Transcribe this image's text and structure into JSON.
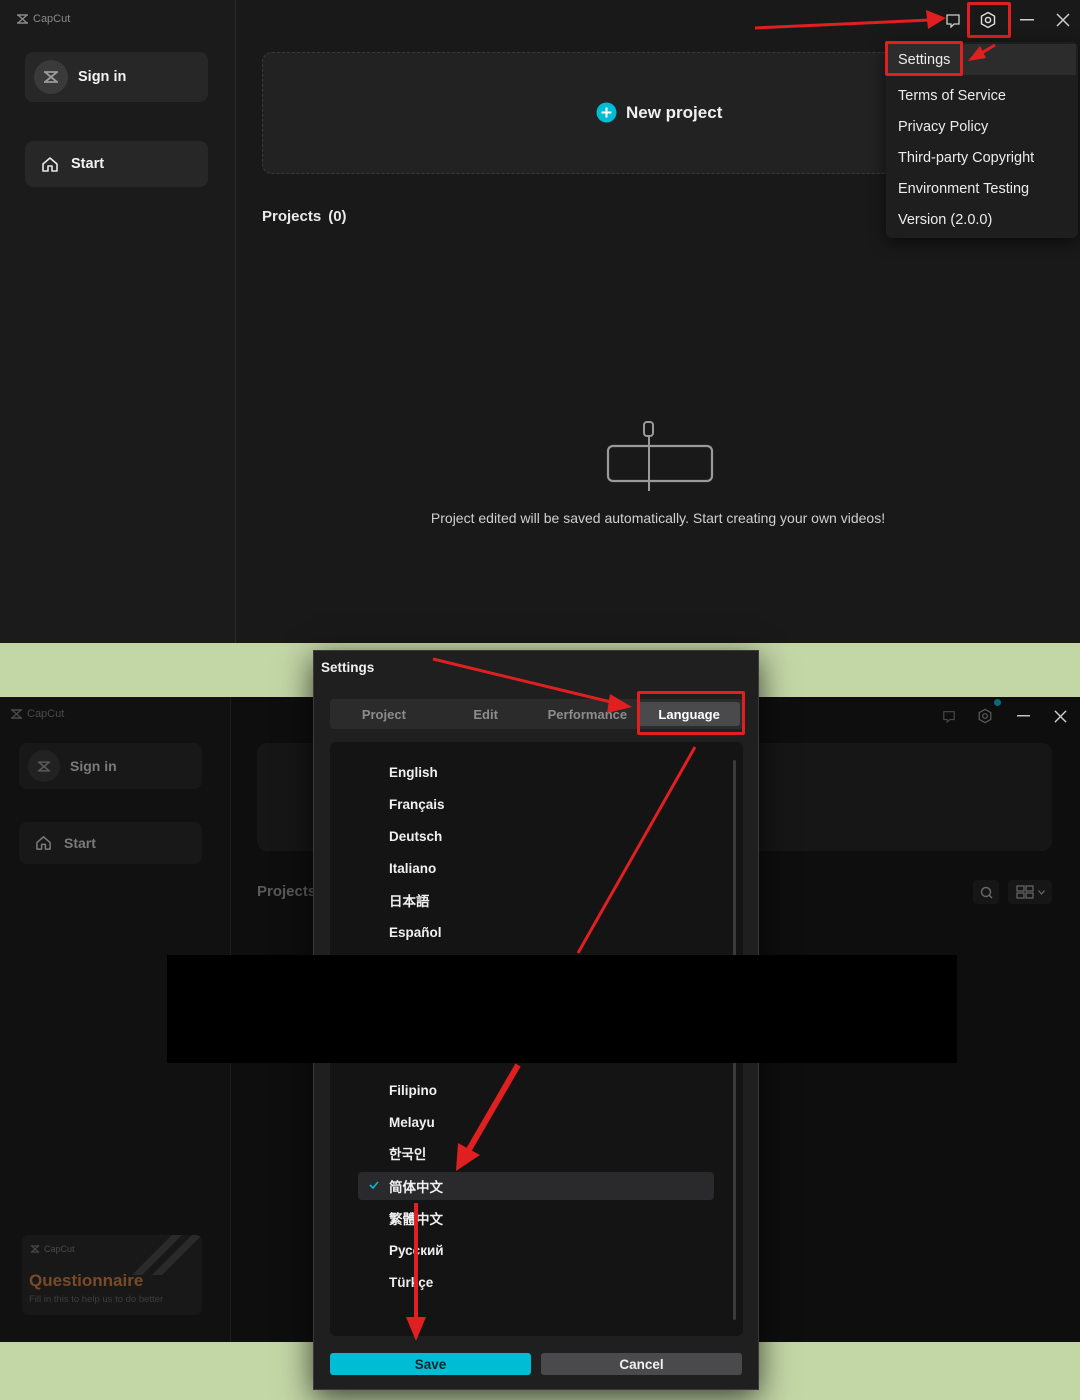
{
  "top": {
    "brand": "CapCut",
    "sidebar": {
      "sign_in_label": "Sign in",
      "start_label": "Start"
    },
    "new_project_label": "New project",
    "projects_label": "Projects",
    "projects_count": "(0)",
    "empty_message": "Project edited will be saved automatically. Start creating your own videos!",
    "menu": {
      "items": [
        "Settings",
        "Terms of Service",
        "Privacy Policy",
        "Third-party Copyright",
        "Environment Testing",
        "Version (2.0.0)"
      ]
    }
  },
  "bottom": {
    "brand": "CapCut",
    "sidebar": {
      "sign_in_label": "Sign in",
      "start_label": "Start"
    },
    "projects_label": "Projects",
    "questionnaire": {
      "brand": "CapCut",
      "title": "Questionnaire",
      "subtitle": "Fill in this to help us to do better"
    }
  },
  "dialog": {
    "title": "Settings",
    "tabs": [
      "Project",
      "Edit",
      "Performance",
      "Language"
    ],
    "active_tab": "Language",
    "languages_top": [
      "English",
      "Français",
      "Deutsch",
      "Italiano",
      "日本語",
      "Español"
    ],
    "languages_bottom": [
      "Filipino",
      "Melayu",
      "한국인",
      "简体中文",
      "繁體中文",
      "Русский",
      "Türkçe"
    ],
    "selected_language": "简体中文",
    "save_label": "Save",
    "cancel_label": "Cancel"
  },
  "colors": {
    "accent": "#00bcd4",
    "annotation_red": "#e02020",
    "background_green": "#c3d6a6"
  }
}
